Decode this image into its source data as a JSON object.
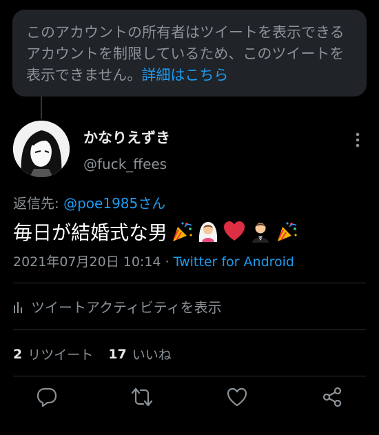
{
  "notice": {
    "text": "このアカウントの所有者はツイートを表示できるアカウントを制限しているため、このツイートを表示できません。",
    "link": "詳細はこちら"
  },
  "user": {
    "name": "かなりえずき",
    "handle": "@fuck_ffees"
  },
  "reply": {
    "prefix": "返信先: ",
    "mention": "@poe1985さん"
  },
  "tweet": {
    "text": "毎日が結婚式な男",
    "emojis": [
      "party-popper",
      "bride-with-veil",
      "red-heart",
      "groom-in-tuxedo",
      "party-popper"
    ]
  },
  "meta": {
    "timestamp": "2021年07月20日 10:14",
    "separator": " · ",
    "client": "Twitter for Android"
  },
  "activity": {
    "label": "ツイートアクティビティを表示"
  },
  "stats": {
    "retweets_count": "2",
    "retweets_label": "リツイート",
    "likes_count": "17",
    "likes_label": "いいね"
  },
  "colors": {
    "accent": "#1d9bf0",
    "background": "#000000",
    "card": "#202327",
    "muted": "#8b9298"
  }
}
